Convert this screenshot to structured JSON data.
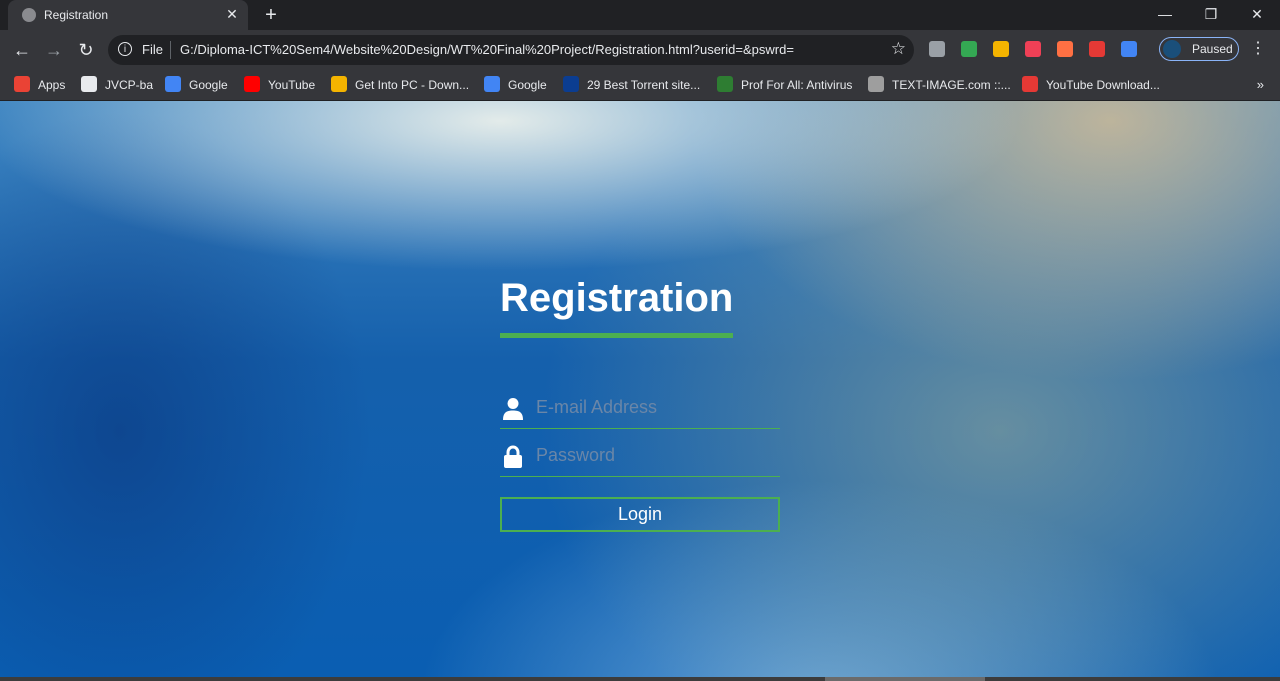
{
  "browser": {
    "tab": {
      "title": "Registration",
      "close_glyph": "✕"
    },
    "new_tab_glyph": "+",
    "window_controls": {
      "minimize": "—",
      "restore": "❐",
      "close": "✕"
    },
    "nav": {
      "back": "←",
      "forward": "→",
      "reload": "↻"
    },
    "address_bar": {
      "info_glyph": "i",
      "scheme_label": "File",
      "url": "G:/Diploma-ICT%20Sem4/Website%20Design/WT%20Final%20Project/Registration.html?userid=&pswrd=",
      "star_glyph": "☆"
    },
    "extensions": [
      {
        "icon": "shield-extension-icon",
        "color": "#9aa0a6"
      },
      {
        "icon": "adblock-shield-icon",
        "color": "#34a853"
      },
      {
        "icon": "globe-extension-icon",
        "color": "#f4b400"
      },
      {
        "icon": "pocket-icon",
        "color": "#ef4056"
      },
      {
        "icon": "fire-extension-icon",
        "color": "#ff7043"
      },
      {
        "icon": "rocket-extension-icon",
        "color": "#e53935"
      },
      {
        "icon": "blue-shield-icon",
        "color": "#4285f4"
      }
    ],
    "profile": {
      "label": "Paused"
    },
    "menu_glyph": "⋮",
    "bookmarks": [
      {
        "label": "Apps",
        "icon": "apps-grid-icon",
        "color": "#ea4335"
      },
      {
        "label": "JVCP-ba",
        "icon": "globe-icon",
        "color": "#e8eaed"
      },
      {
        "label": "Google",
        "icon": "google-icon",
        "color": "#4285f4"
      },
      {
        "label": "YouTube",
        "icon": "youtube-icon",
        "color": "#ff0000"
      },
      {
        "label": "Get Into PC - Down...",
        "icon": "getintopc-icon",
        "color": "#f4b400"
      },
      {
        "label": "Google",
        "icon": "google-icon",
        "color": "#4285f4"
      },
      {
        "label": "29 Best Torrent site...",
        "icon": "vpn-icon",
        "color": "#0b3d91"
      },
      {
        "label": "Prof For All: Antivirus",
        "icon": "profforall-icon",
        "color": "#2e7d32"
      },
      {
        "label": "TEXT-IMAGE.com ::...",
        "icon": "text-image-icon",
        "color": "#9e9e9e"
      },
      {
        "label": "YouTube Download...",
        "icon": "refresh-download-icon",
        "color": "#e53935"
      }
    ],
    "bookmarks_more_glyph": "»"
  },
  "page": {
    "title": "Registration",
    "accent_color": "#4caf50",
    "email": {
      "placeholder": "E-mail Address",
      "value": ""
    },
    "password": {
      "placeholder": "Password",
      "value": ""
    },
    "login_button_label": "Login"
  }
}
